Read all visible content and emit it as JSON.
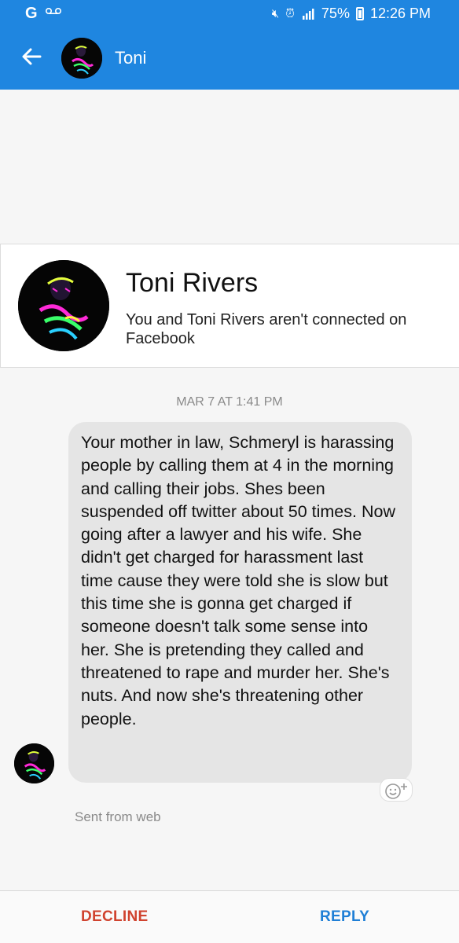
{
  "status_bar": {
    "carrier_icon": "google-g-icon",
    "voicemail_icon": "voicemail-icon",
    "icons": [
      "mute-icon",
      "alarm-icon",
      "lte-signal-icon"
    ],
    "battery": "75%",
    "time": "12:26 PM"
  },
  "header": {
    "back_icon": "back-arrow-icon",
    "contact_name": "Toni"
  },
  "profile": {
    "name": "Toni Rivers",
    "connection_note": "You and Toni Rivers aren't connected on Facebook"
  },
  "conversation": {
    "timestamp": "MAR 7 AT 1:41 PM",
    "message": "Your mother in law, Schmeryl is harassing people by calling them at 4 in the morning and calling their jobs. Shes been suspended off twitter about 50 times. Now going after a lawyer and his wife. She didn't get charged for harassment last time cause they were told she is slow but this time she is gonna get charged if someone doesn't talk some sense into her. She is pretending they called and threatened to rape and murder her. She's nuts. And now she's threatening other people.",
    "sent_from": "Sent from web"
  },
  "actions": {
    "decline": "DECLINE",
    "reply": "REPLY"
  },
  "colors": {
    "brand_blue": "#1f86e0",
    "decline_red": "#d0432f",
    "reply_blue": "#1f7fd6",
    "bubble_gray": "#e5e5e5"
  }
}
